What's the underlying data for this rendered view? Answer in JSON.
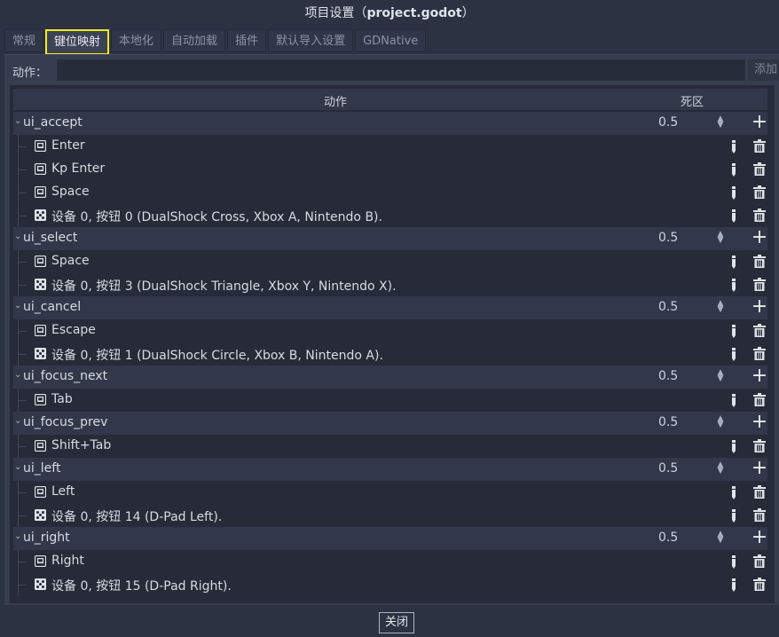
{
  "window": {
    "title_prefix": "项目设置（",
    "title_project": "project.godot",
    "title_suffix": "）"
  },
  "tabs": [
    {
      "label": "常规"
    },
    {
      "label": "键位映射"
    },
    {
      "label": "本地化"
    },
    {
      "label": "自动加载"
    },
    {
      "label": "插件"
    },
    {
      "label": "默认导入设置"
    },
    {
      "label": "GDNative"
    }
  ],
  "action_bar": {
    "label": "动作：",
    "input_value": "",
    "add_label": "添加"
  },
  "tree": {
    "header_action": "动作",
    "header_deadzone": "死区"
  },
  "actions": [
    {
      "name": "ui_accept",
      "deadzone": "0.5",
      "events": [
        {
          "type": "key",
          "text": "Enter"
        },
        {
          "type": "key",
          "text": "Kp Enter"
        },
        {
          "type": "key",
          "text": "Space"
        },
        {
          "type": "joy",
          "text": "设备 0, 按钮 0 (DualShock Cross, Xbox A, Nintendo B)."
        }
      ]
    },
    {
      "name": "ui_select",
      "deadzone": "0.5",
      "events": [
        {
          "type": "key",
          "text": "Space"
        },
        {
          "type": "joy",
          "text": "设备 0, 按钮 3 (DualShock Triangle, Xbox Y, Nintendo X)."
        }
      ]
    },
    {
      "name": "ui_cancel",
      "deadzone": "0.5",
      "events": [
        {
          "type": "key",
          "text": "Escape"
        },
        {
          "type": "joy",
          "text": "设备 0, 按钮 1 (DualShock Circle, Xbox B, Nintendo A)."
        }
      ]
    },
    {
      "name": "ui_focus_next",
      "deadzone": "0.5",
      "events": [
        {
          "type": "key",
          "text": "Tab"
        }
      ]
    },
    {
      "name": "ui_focus_prev",
      "deadzone": "0.5",
      "events": [
        {
          "type": "key",
          "text": "Shift+Tab"
        }
      ]
    },
    {
      "name": "ui_left",
      "deadzone": "0.5",
      "events": [
        {
          "type": "key",
          "text": "Left"
        },
        {
          "type": "joy",
          "text": "设备 0, 按钮 14 (D-Pad Left)."
        }
      ]
    },
    {
      "name": "ui_right",
      "deadzone": "0.5",
      "events": [
        {
          "type": "key",
          "text": "Right"
        },
        {
          "type": "joy",
          "text": "设备 0, 按钮 15 (D-Pad Right)."
        }
      ]
    }
  ],
  "footer": {
    "close_label": "关闭"
  },
  "colors": {
    "accent_highlight": "#f3ec23",
    "background": "#2c3242",
    "tree_bg": "#262b37"
  }
}
